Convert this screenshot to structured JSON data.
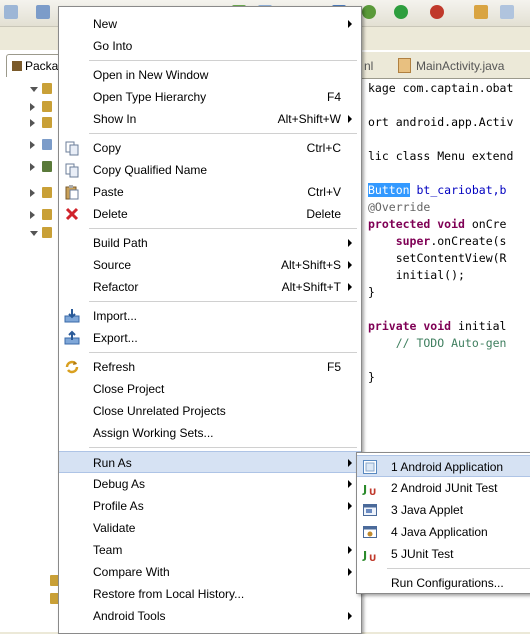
{
  "editor": {
    "tabs": [
      "nl",
      "MainActivity.java"
    ],
    "code_lines": [
      {
        "parts": [
          {
            "t": "kage com.captain.obat",
            "c": ""
          }
        ]
      },
      {
        "parts": [
          {
            "t": "",
            "c": ""
          }
        ]
      },
      {
        "parts": [
          {
            "t": "ort android.app.Activ",
            "c": ""
          }
        ]
      },
      {
        "parts": [
          {
            "t": "",
            "c": ""
          }
        ]
      },
      {
        "parts": [
          {
            "t": "lic class Menu extend",
            "c": ""
          }
        ]
      },
      {
        "parts": [
          {
            "t": "",
            "c": ""
          }
        ]
      },
      {
        "parts": [
          {
            "t": "Button",
            "c": "sel"
          },
          {
            "t": " bt_cariobat,b",
            "c": "fld"
          }
        ]
      },
      {
        "parts": [
          {
            "t": "@Override",
            "c": "ann"
          }
        ]
      },
      {
        "parts": [
          {
            "t": "protected void ",
            "c": "kw"
          },
          {
            "t": "onCre",
            "c": ""
          }
        ]
      },
      {
        "parts": [
          {
            "t": "    super",
            "c": "kw"
          },
          {
            "t": ".onCreate(s",
            "c": ""
          }
        ]
      },
      {
        "parts": [
          {
            "t": "    setContentView(R",
            "c": ""
          }
        ]
      },
      {
        "parts": [
          {
            "t": "    initial();",
            "c": ""
          }
        ]
      },
      {
        "parts": [
          {
            "t": "}",
            "c": ""
          }
        ]
      },
      {
        "parts": [
          {
            "t": "",
            "c": ""
          }
        ]
      },
      {
        "parts": [
          {
            "t": "private void ",
            "c": "kw"
          },
          {
            "t": "initial",
            "c": ""
          }
        ]
      },
      {
        "parts": [
          {
            "t": "    // TODO Auto-gen",
            "c": "cm"
          }
        ]
      },
      {
        "parts": [
          {
            "t": "",
            "c": ""
          }
        ]
      },
      {
        "parts": [
          {
            "t": "}",
            "c": ""
          }
        ]
      }
    ]
  },
  "side": {
    "tab_label": "Packa"
  },
  "menu": {
    "items": [
      {
        "label": "New",
        "shortcut": "",
        "submenu": true,
        "icon": ""
      },
      {
        "label": "Go Into",
        "shortcut": "",
        "submenu": false,
        "icon": ""
      },
      {
        "sep": true
      },
      {
        "label": "Open in New Window",
        "shortcut": "",
        "submenu": false,
        "icon": ""
      },
      {
        "label": "Open Type Hierarchy",
        "shortcut": "F4",
        "submenu": false,
        "icon": ""
      },
      {
        "label": "Show In",
        "shortcut": "Alt+Shift+W",
        "submenu": true,
        "icon": ""
      },
      {
        "sep": true
      },
      {
        "label": "Copy",
        "shortcut": "Ctrl+C",
        "submenu": false,
        "icon": "copy-icon"
      },
      {
        "label": "Copy Qualified Name",
        "shortcut": "",
        "submenu": false,
        "icon": "copy-icon"
      },
      {
        "label": "Paste",
        "shortcut": "Ctrl+V",
        "submenu": false,
        "icon": "paste-icon"
      },
      {
        "label": "Delete",
        "shortcut": "Delete",
        "submenu": false,
        "icon": "delete-icon"
      },
      {
        "sep": true
      },
      {
        "label": "Build Path",
        "shortcut": "",
        "submenu": true,
        "icon": ""
      },
      {
        "label": "Source",
        "shortcut": "Alt+Shift+S",
        "submenu": true,
        "icon": ""
      },
      {
        "label": "Refactor",
        "shortcut": "Alt+Shift+T",
        "submenu": true,
        "icon": ""
      },
      {
        "sep": true
      },
      {
        "label": "Import...",
        "shortcut": "",
        "submenu": false,
        "icon": "import-icon"
      },
      {
        "label": "Export...",
        "shortcut": "",
        "submenu": false,
        "icon": "export-icon"
      },
      {
        "sep": true
      },
      {
        "label": "Refresh",
        "shortcut": "F5",
        "submenu": false,
        "icon": "refresh-icon"
      },
      {
        "label": "Close Project",
        "shortcut": "",
        "submenu": false,
        "icon": ""
      },
      {
        "label": "Close Unrelated Projects",
        "shortcut": "",
        "submenu": false,
        "icon": ""
      },
      {
        "label": "Assign Working Sets...",
        "shortcut": "",
        "submenu": false,
        "icon": ""
      },
      {
        "sep": true
      },
      {
        "label": "Run As",
        "shortcut": "",
        "submenu": true,
        "icon": "",
        "highlighted": true
      },
      {
        "label": "Debug As",
        "shortcut": "",
        "submenu": true,
        "icon": ""
      },
      {
        "label": "Profile As",
        "shortcut": "",
        "submenu": true,
        "icon": ""
      },
      {
        "label": "Validate",
        "shortcut": "",
        "submenu": false,
        "icon": ""
      },
      {
        "label": "Team",
        "shortcut": "",
        "submenu": true,
        "icon": ""
      },
      {
        "label": "Compare With",
        "shortcut": "",
        "submenu": true,
        "icon": ""
      },
      {
        "label": "Restore from Local History...",
        "shortcut": "",
        "submenu": false,
        "icon": ""
      },
      {
        "label": "Android Tools",
        "shortcut": "",
        "submenu": true,
        "icon": ""
      }
    ]
  },
  "submenu": {
    "items": [
      {
        "label": "1 Android Application",
        "icon": "android-app-icon",
        "highlighted": true
      },
      {
        "label": "2 Android JUnit Test",
        "icon": "junit-icon"
      },
      {
        "label": "3 Java Applet",
        "icon": "applet-icon"
      },
      {
        "label": "4 Java Application",
        "icon": "java-app-icon"
      },
      {
        "label": "5 JUnit Test",
        "icon": "junit-icon"
      },
      {
        "sep": true
      },
      {
        "label": "Run Configurations...",
        "icon": ""
      }
    ]
  },
  "colors": {
    "highlight": "#d6e2f3",
    "selection": "#3399ff"
  }
}
